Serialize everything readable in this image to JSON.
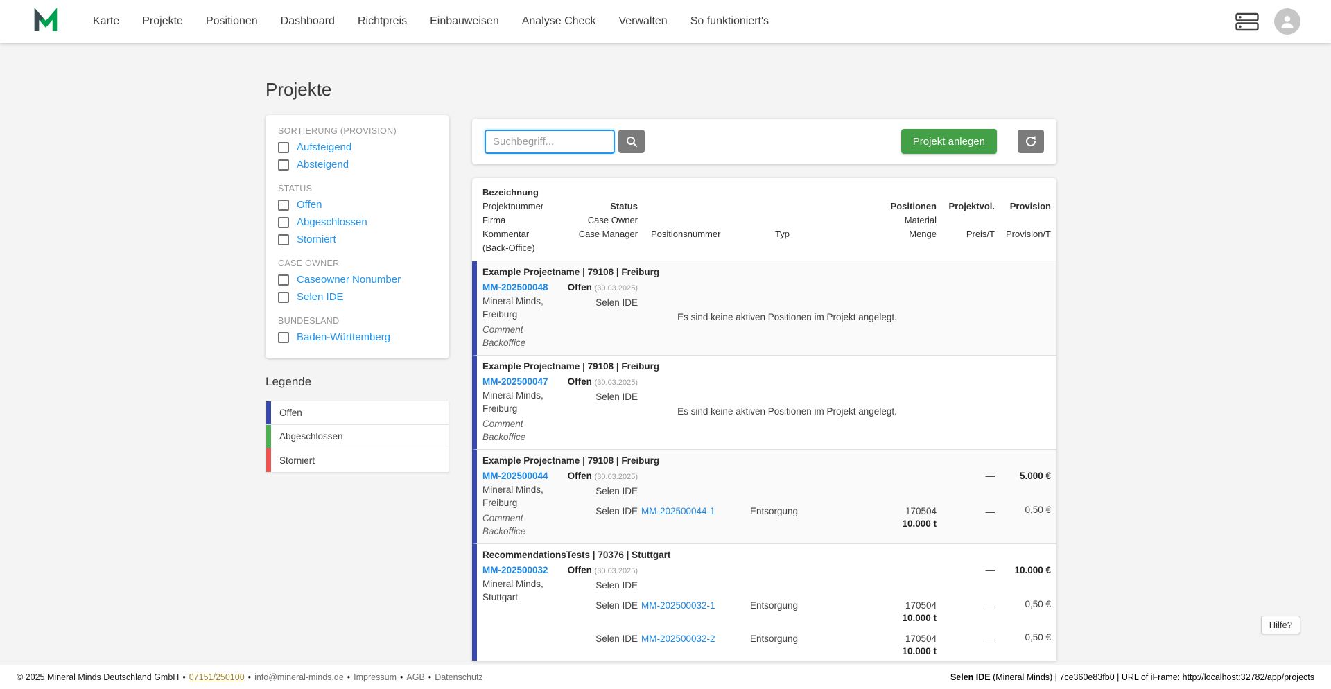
{
  "navbar": {
    "logo_name": "mineral-minds-logo",
    "items": [
      "Karte",
      "Projekte",
      "Positionen",
      "Dashboard",
      "Richtpreis",
      "Einbauweisen",
      "Analyse Check",
      "Verwalten",
      "So funktioniert's"
    ],
    "right_icons": [
      "server-icon",
      "user-avatar"
    ]
  },
  "page": {
    "title": "Projekte"
  },
  "filters": {
    "sections": [
      {
        "heading": "SORTIERUNG (PROVISION)",
        "options": [
          "Aufsteigend",
          "Absteigend"
        ]
      },
      {
        "heading": "STATUS",
        "options": [
          "Offen",
          "Abgeschlossen",
          "Storniert"
        ]
      },
      {
        "heading": "CASE OWNER",
        "options": [
          "Caseowner Nonumber",
          "Selen IDE"
        ]
      },
      {
        "heading": "BUNDESLAND",
        "options": [
          "Baden-Württemberg"
        ]
      }
    ]
  },
  "legend": {
    "title": "Legende",
    "items": [
      {
        "label": "Offen",
        "color": "#3949ab"
      },
      {
        "label": "Abgeschlossen",
        "color": "#4caf50"
      },
      {
        "label": "Storniert",
        "color": "#ef5350"
      }
    ]
  },
  "toolbar": {
    "search_placeholder": "Suchbegriff...",
    "search_icon": "search-icon",
    "create_label": "Projekt anlegen",
    "refresh_icon": "refresh-icon"
  },
  "table": {
    "columns": [
      {
        "align": "left",
        "lines": [
          {
            "row": 0,
            "text": "Bezeichnung",
            "bold": true
          },
          {
            "row": 1,
            "text": "Projektnummer"
          },
          {
            "row": 2,
            "text": "Firma"
          },
          {
            "row": 3,
            "text": "Kommentar"
          },
          {
            "row": 4,
            "text": "(Back-Office)"
          }
        ]
      },
      {
        "align": "right",
        "lines": [
          {
            "row": 1,
            "text": "Status",
            "bold": true
          },
          {
            "row": 2,
            "text": "Case Owner"
          },
          {
            "row": 3,
            "text": "Case Manager"
          }
        ]
      },
      {
        "align": "left",
        "pad": 19,
        "lines": [
          {
            "row": 3,
            "text": "Positionsnummer"
          }
        ]
      },
      {
        "align": "left",
        "pad": 36,
        "lines": [
          {
            "row": 3,
            "text": "Typ"
          }
        ]
      },
      {
        "align": "right",
        "lines": [
          {
            "row": 1,
            "text": "Positionen",
            "bold": true
          },
          {
            "row": 2,
            "text": "Material"
          },
          {
            "row": 3,
            "text": "Menge"
          }
        ]
      },
      {
        "align": "right",
        "lines": [
          {
            "row": 1,
            "text": "Projektvol.",
            "bold": true
          },
          {
            "row": 3,
            "text": "Preis/T"
          }
        ]
      },
      {
        "align": "right",
        "lines": [
          {
            "row": 1,
            "text": "Provision",
            "bold": true
          },
          {
            "row": 3,
            "text": "Provision/T"
          }
        ]
      }
    ],
    "groups": [
      {
        "title": "Example Projectname | 79108 | Freiburg",
        "project_link": "MM-202500048",
        "company_lines": [
          "Mineral Minds,",
          "Freiburg"
        ],
        "comment": "Comment",
        "backoffice": "Backoffice",
        "status": "Offen",
        "status_date": "(30.03.2025)",
        "case_owner": "Selen IDE",
        "empty_message": "Es sind keine aktiven Positionen im Projekt angelegt.",
        "preis_t": "",
        "provision_total": "",
        "positions": []
      },
      {
        "title": "Example Projectname | 79108 | Freiburg",
        "project_link": "MM-202500047",
        "company_lines": [
          "Mineral Minds,",
          "Freiburg"
        ],
        "comment": "Comment",
        "backoffice": "Backoffice",
        "status": "Offen",
        "status_date": "(30.03.2025)",
        "case_owner": "Selen IDE",
        "empty_message": "Es sind keine aktiven Positionen im Projekt angelegt.",
        "preis_t": "",
        "provision_total": "",
        "positions": []
      },
      {
        "title": "Example Projectname | 79108 | Freiburg",
        "project_link": "MM-202500044",
        "company_lines": [
          "Mineral Minds,",
          "Freiburg"
        ],
        "comment": "Comment",
        "backoffice": "Backoffice",
        "status": "Offen",
        "status_date": "(30.03.2025)",
        "case_owner": "Selen IDE",
        "empty_message": "",
        "preis_t": "—",
        "provision_total": "5.000 €",
        "positions": [
          {
            "case_owner": "Selen IDE",
            "number": "MM-202500044-1",
            "typ": "Entsorgung",
            "material": "170504",
            "menge": "10.000 t",
            "preis_t": "—",
            "provision_t": "0,50 €"
          }
        ]
      },
      {
        "title": "RecommendationsTests | 70376 | Stuttgart",
        "project_link": "MM-202500032",
        "company_lines": [
          "Mineral Minds,",
          "Stuttgart"
        ],
        "comment": "",
        "backoffice": "",
        "status": "Offen",
        "status_date": "(30.03.2025)",
        "case_owner": "Selen IDE",
        "empty_message": "",
        "preis_t": "—",
        "provision_total": "10.000 €",
        "positions": [
          {
            "case_owner": "Selen IDE",
            "number": "MM-202500032-1",
            "typ": "Entsorgung",
            "material": "170504",
            "menge": "10.000 t",
            "preis_t": "—",
            "provision_t": "0,50 €"
          },
          {
            "case_owner": "Selen IDE",
            "number": "MM-202500032-2",
            "typ": "Entsorgung",
            "material": "170504",
            "menge": "10.000 t",
            "preis_t": "—",
            "provision_t": "0,50 €"
          }
        ]
      }
    ]
  },
  "help": {
    "label": "Hilfe?"
  },
  "footer": {
    "separator": "•",
    "items": [
      {
        "text": "© 2025 Mineral Minds Deutschland GmbH",
        "link": false
      },
      {
        "text": "07151/250100",
        "link": true,
        "style": "phone"
      },
      {
        "text": "info@mineral-minds.de",
        "link": true
      },
      {
        "text": "Impressum",
        "link": true
      },
      {
        "text": "AGB",
        "link": true
      },
      {
        "text": "Datenschutz",
        "link": true
      }
    ],
    "session": [
      {
        "text": "Selen IDE",
        "bold": true
      },
      {
        "text": " (Mineral Minds) | 7ce360e83fb0 | URL of iFrame: http://localhost:32782/app/projects",
        "bold": false
      }
    ]
  },
  "colors": {
    "accent_green": "#43a047",
    "link_blue": "#1e88e5",
    "filter_link_blue": "#2196f3",
    "status_open": "#3949ab",
    "status_done": "#4caf50",
    "status_cancelled": "#ef5350"
  }
}
